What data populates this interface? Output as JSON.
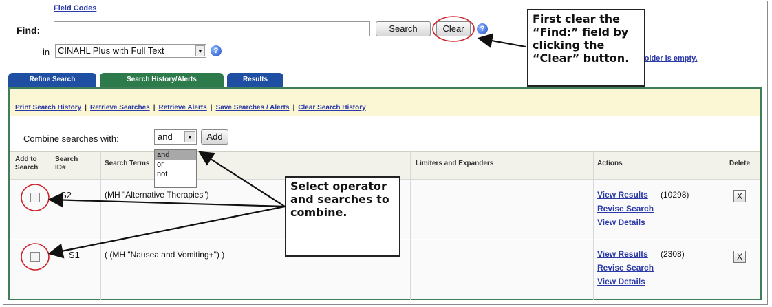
{
  "search": {
    "field_codes_link": "Field Codes",
    "find_label": "Find:",
    "find_value": "",
    "search_button": "Search",
    "clear_button": "Clear",
    "in_label": "in",
    "database_select": "CINAHL Plus with Full Text"
  },
  "folder_text": "Folder is empty.",
  "tabs": [
    {
      "label": "Refine Search"
    },
    {
      "label": "Search History/Alerts"
    },
    {
      "label": "Results"
    }
  ],
  "history_links": [
    "Print Search History",
    "Retrieve Searches",
    "Retrieve Alerts",
    "Save Searches / Alerts",
    "Clear Search History"
  ],
  "combine": {
    "label": "Combine searches with:",
    "selected": "and",
    "options": [
      "and",
      "or",
      "not"
    ],
    "add_button": "Add"
  },
  "table": {
    "headers": {
      "add_to_search": "Add to Search",
      "search_id": "Search ID#",
      "search_terms": "Search Terms",
      "limiters": "Limiters and Expanders",
      "actions": "Actions",
      "delete": "Delete"
    },
    "rows": [
      {
        "id": "S2",
        "terms": "(MH \"Alternative Therapies\")",
        "view_results": "View Results",
        "count": "(10298)",
        "revise": "Revise Search",
        "details": "View Details",
        "delete": "X"
      },
      {
        "id": "S1",
        "terms": "( (MH \"Nausea and Vomiting+\") )",
        "view_results": "View Results",
        "count": "(2308)",
        "revise": "Revise Search",
        "details": "View Details",
        "delete": "X"
      }
    ]
  },
  "callouts": {
    "clear": "First clear the “Find:” field by clicking the “Clear” button.",
    "select": "Select operator and searches to combine."
  },
  "icons": [
    "help-icon",
    "folder-icon",
    "chevron-down-icon",
    "checkbox-icon",
    "close-icon"
  ],
  "colors": {
    "link": "#2b3aa8",
    "tab_blue": "#1f4fa3",
    "tab_green": "#2d7a4a",
    "panel_border": "#3f7e58",
    "highlight_circle": "#d0202a",
    "link_bar_bg": "#fbf7d4"
  }
}
